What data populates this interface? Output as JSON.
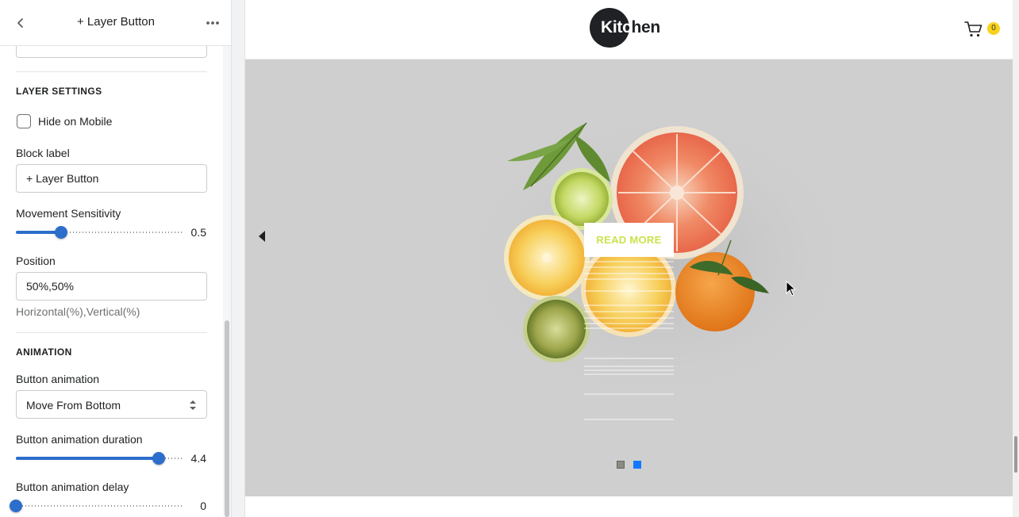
{
  "sidebar": {
    "title": "+ Layer Button",
    "layer_settings": {
      "heading": "LAYER SETTINGS",
      "hide_on_mobile": {
        "label": "Hide on Mobile",
        "checked": false
      },
      "block_label": {
        "label": "Block label",
        "value": "+ Layer Button"
      },
      "movement_sensitivity": {
        "label": "Movement Sensitivity",
        "value": "0.5",
        "fraction": 0.27
      },
      "position": {
        "label": "Position",
        "value": "50%,50%",
        "help": "Horizontal(%),Vertical(%)"
      }
    },
    "animation": {
      "heading": "ANIMATION",
      "button_animation": {
        "label": "Button animation",
        "value": "Move From Bottom"
      },
      "duration": {
        "label": "Button animation duration",
        "value": "4.4",
        "fraction": 0.85
      },
      "delay": {
        "label": "Button animation delay",
        "value": "0",
        "fraction": 0.0
      }
    }
  },
  "preview": {
    "logo": {
      "white_part": "Kitc",
      "dark_part": "hen"
    },
    "cart_count": "0",
    "slide": {
      "button_label": "READ MORE",
      "slide_count": 2,
      "active_slide": 2
    },
    "colors": {
      "accent": "#2c6ecb",
      "slide_bg": "#cfcfcf",
      "button_text": "#c9e34b",
      "active_dot": "#1479ff",
      "badge": "#f8d21b"
    }
  },
  "icons": [
    "chevron-left-icon",
    "more-horizontal-icon",
    "cart-icon",
    "select-arrows-icon",
    "triangle-left-icon",
    "mouse-pointer-icon"
  ]
}
